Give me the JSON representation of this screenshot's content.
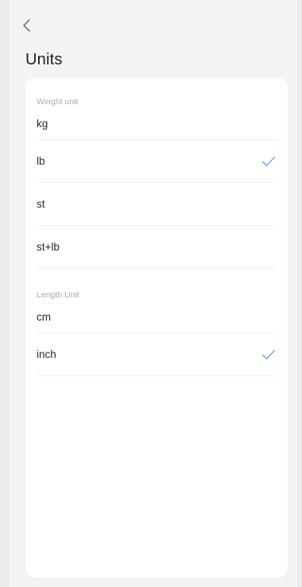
{
  "header": {
    "back_icon": "chevron-left-icon",
    "title": "Units"
  },
  "weight": {
    "section_label": "Weight unit",
    "options": [
      {
        "label": "kg",
        "selected": false
      },
      {
        "label": "lb",
        "selected": true
      },
      {
        "label": "st",
        "selected": false
      },
      {
        "label": "st+lb",
        "selected": false
      }
    ]
  },
  "length": {
    "section_label": "Length Unit",
    "options": [
      {
        "label": "cm",
        "selected": false
      },
      {
        "label": "inch",
        "selected": true
      }
    ]
  },
  "colors": {
    "background": "#ececec",
    "card": "#ffffff",
    "check": "#5b8fe0",
    "section_label": "#a8a8a8"
  },
  "icons": {
    "selected": "checkmark-icon"
  }
}
